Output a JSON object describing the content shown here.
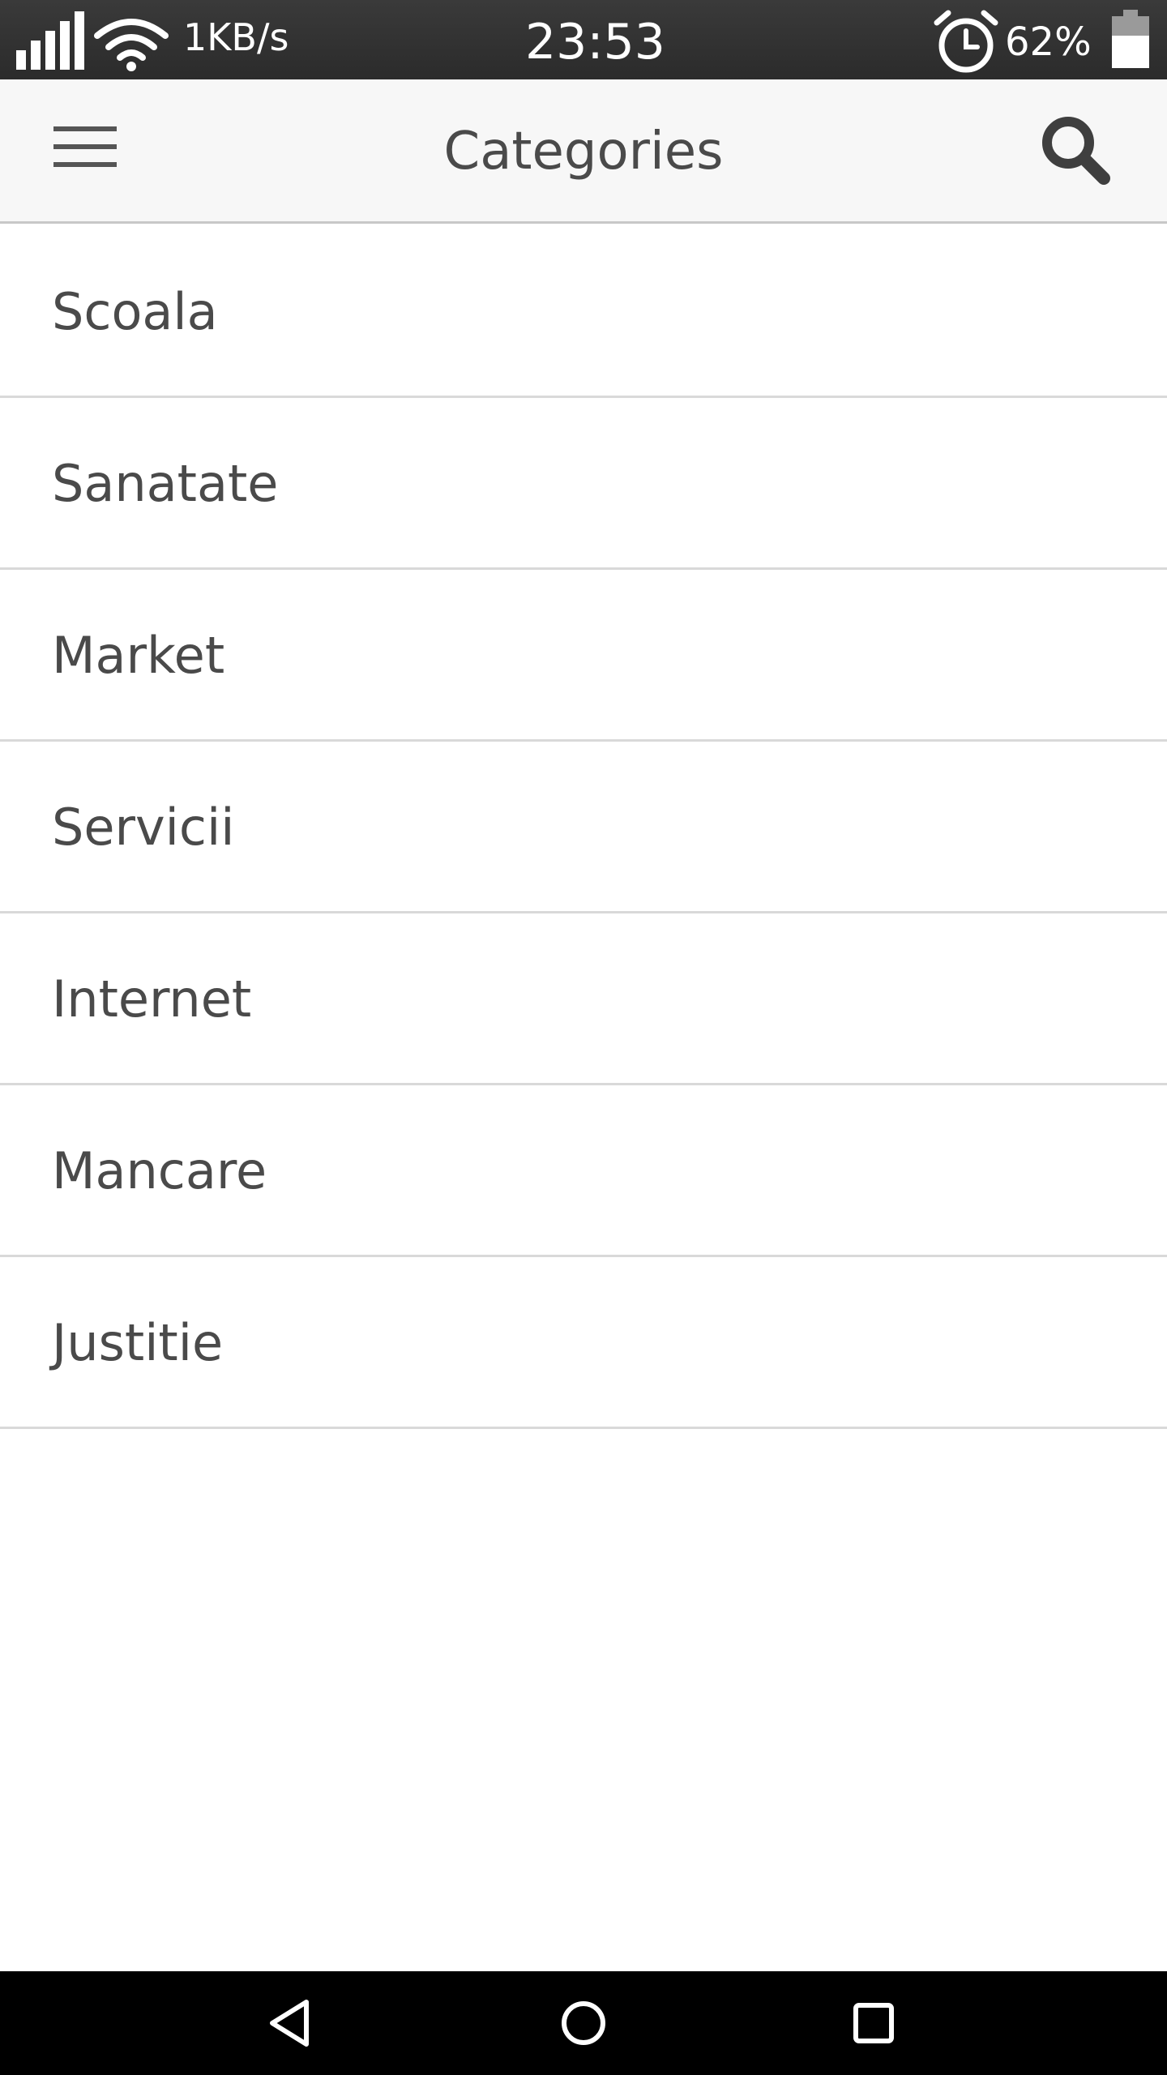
{
  "status_bar": {
    "network_speed": "1KB/s",
    "time": "23:53",
    "battery_percent": "62%",
    "icons": [
      "signal-icon",
      "wifi-icon",
      "alarm-icon",
      "battery-icon"
    ],
    "battery_level": 0.62
  },
  "app_bar": {
    "title": "Categories",
    "menu_icon": "hamburger-menu-icon",
    "search_icon": "search-icon"
  },
  "categories": [
    {
      "label": "Scoala"
    },
    {
      "label": "Sanatate"
    },
    {
      "label": "Market"
    },
    {
      "label": "Servicii"
    },
    {
      "label": "Internet"
    },
    {
      "label": "Mancare"
    },
    {
      "label": "Justitie"
    }
  ],
  "nav_bar": {
    "icons": [
      "back-icon",
      "home-icon",
      "recents-icon"
    ]
  },
  "colors": {
    "status_bar": "#2e2e2e",
    "app_bar": "#f7f7f7",
    "text": "#4a4a4a",
    "divider": "#d9d9d9",
    "nav_bar": "#000000"
  }
}
